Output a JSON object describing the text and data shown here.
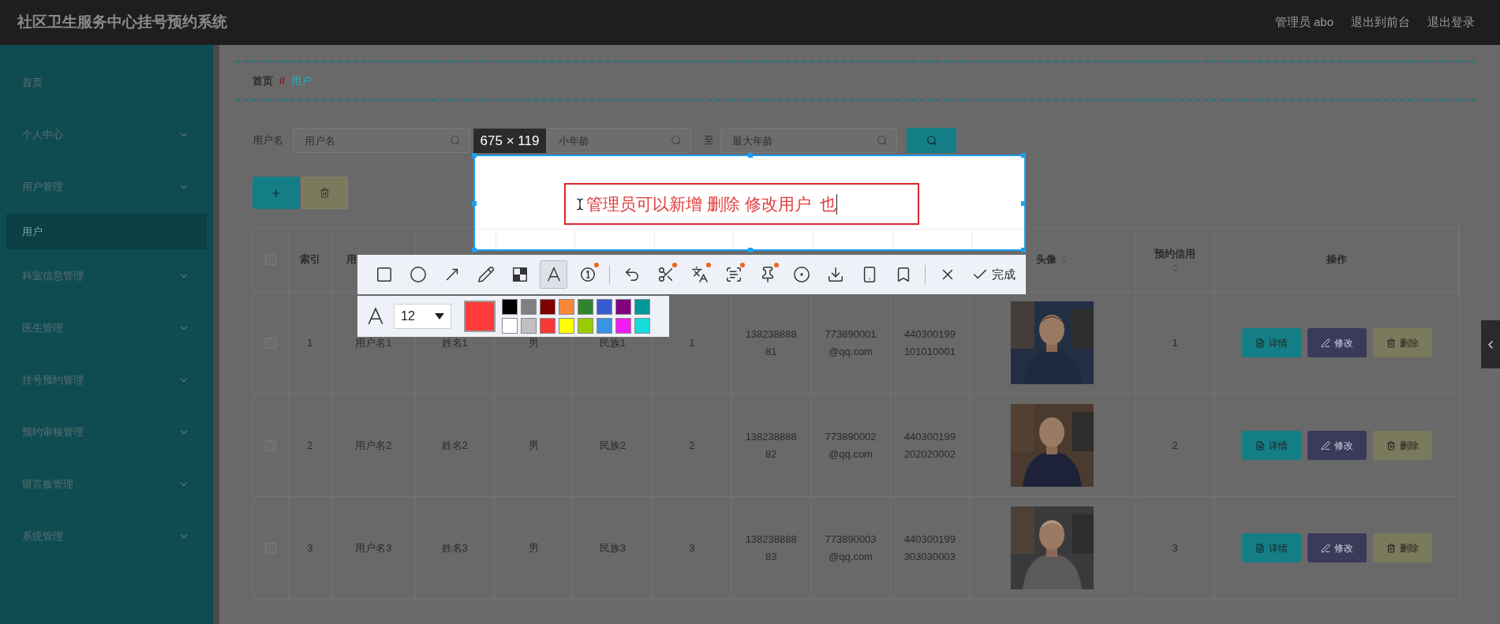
{
  "header": {
    "title": "社区卫生服务中心挂号预约系统",
    "links": [
      "管理员 abo",
      "退出到前台",
      "退出登录"
    ]
  },
  "sidebar": {
    "items": [
      {
        "kind": "link",
        "label": "首页",
        "selected": false
      },
      {
        "kind": "group",
        "label": "个人中心",
        "selected": false
      },
      {
        "kind": "group",
        "label": "用户管理",
        "selected": false,
        "children": [
          {
            "label": "用户",
            "selected": true
          }
        ]
      },
      {
        "kind": "group",
        "label": "科室信息管理",
        "selected": false
      },
      {
        "kind": "group",
        "label": "医生管理",
        "selected": false
      },
      {
        "kind": "group",
        "label": "挂号预约管理",
        "selected": false
      },
      {
        "kind": "group",
        "label": "预约审核管理",
        "selected": false
      },
      {
        "kind": "group",
        "label": "留言板管理",
        "selected": false
      },
      {
        "kind": "group",
        "label": "系统管理",
        "selected": false
      }
    ]
  },
  "breadcrumb": {
    "items": [
      "首页",
      "用户"
    ],
    "separator": "//"
  },
  "search": {
    "fields": [
      {
        "label": "用户名",
        "placeholder": "用户名"
      },
      {
        "placeholder": "小年龄"
      },
      {
        "label": "至",
        "placeholder": "最大年龄"
      }
    ]
  },
  "table": {
    "all_checked": false,
    "columns": [
      {
        "kind": "text",
        "label": "索引",
        "sortable": false
      },
      {
        "kind": "text",
        "label": "用"
      },
      {
        "kind": "covered"
      },
      {
        "kind": "covered"
      },
      {
        "kind": "covered"
      },
      {
        "kind": "covered"
      },
      {
        "kind": "covered"
      },
      {
        "kind": "covered"
      },
      {
        "kind": "covered"
      },
      {
        "kind": "text",
        "label": "头像",
        "sortable": true
      },
      {
        "kind": "text",
        "label": "预约信用",
        "sortable": true
      },
      {
        "kind": "text",
        "label": "操作",
        "sortable": false
      }
    ],
    "rows": [
      {
        "checked": false,
        "cells": [
          "1",
          "用户名1",
          "姓名1",
          "男",
          "民族1",
          "1",
          "13823888881",
          "773890001@qq.com",
          "440300199101010001",
          "",
          "1"
        ],
        "actions": [
          "详情",
          "修改",
          "删除"
        ]
      },
      {
        "checked": false,
        "cells": [
          "2",
          "用户名2",
          "姓名2",
          "男",
          "民族2",
          "2",
          "13823888882",
          "773890002@qq.com",
          "440300199202020002",
          "",
          "2"
        ],
        "actions": [
          "详情",
          "修改",
          "删除"
        ]
      },
      {
        "checked": false,
        "cells": [
          "3",
          "用户名3",
          "姓名3",
          "男",
          "民族3",
          "3",
          "13823888883",
          "773890003@qq.com",
          "440300199303030003",
          "",
          "3"
        ],
        "actions": [
          "详情",
          "修改",
          "删除"
        ]
      }
    ]
  },
  "overlay": {
    "size_label": "675 × 119",
    "text": "管理员可以新增 删除 修改用户  也",
    "tool_groups": [
      [
        {
          "kind": "rect",
          "selected": false,
          "badge": false
        },
        {
          "kind": "ellipse",
          "selected": false,
          "badge": false
        },
        {
          "kind": "arrow",
          "selected": false,
          "badge": false
        },
        {
          "kind": "pencil",
          "selected": false,
          "badge": false
        },
        {
          "kind": "mosaic",
          "selected": false,
          "badge": false
        },
        {
          "kind": "text",
          "selected": true,
          "badge": false
        },
        {
          "kind": "number",
          "selected": false,
          "badge": true
        }
      ],
      [
        {
          "kind": "undo",
          "selected": false,
          "badge": false
        },
        {
          "kind": "cutout",
          "selected": false,
          "badge": true
        },
        {
          "kind": "translate",
          "selected": false,
          "badge": true
        },
        {
          "kind": "ocr",
          "selected": false,
          "badge": true
        },
        {
          "kind": "pin",
          "selected": false,
          "badge": true
        },
        {
          "kind": "record",
          "selected": false,
          "badge": false
        },
        {
          "kind": "download",
          "selected": false,
          "badge": false
        },
        {
          "kind": "long",
          "selected": false,
          "badge": false
        },
        {
          "kind": "bookmark",
          "selected": false,
          "badge": false
        }
      ],
      [
        {
          "kind": "close",
          "selected": false,
          "badge": false
        },
        {
          "kind": "done",
          "label": "完成",
          "selected": false,
          "badge": false
        }
      ]
    ],
    "text_options": {
      "font_size": "12",
      "current": {
        "color": "#ff3b3b"
      },
      "palette": [
        {
          "color": "#000000"
        },
        {
          "color": "#808080"
        },
        {
          "color": "#800000"
        },
        {
          "color": "#f7883a"
        },
        {
          "color": "#308430"
        },
        {
          "color": "#385ad3"
        },
        {
          "color": "#800080"
        },
        {
          "color": "#009999"
        },
        {
          "color": "#ffffff"
        },
        {
          "color": "#c0c0c0"
        },
        {
          "color": "#fb3838"
        },
        {
          "color": "#ffff00"
        },
        {
          "color": "#99cc00"
        },
        {
          "color": "#3894e4"
        },
        {
          "color": "#f31bf3"
        },
        {
          "color": "#16dcdc"
        }
      ]
    }
  }
}
